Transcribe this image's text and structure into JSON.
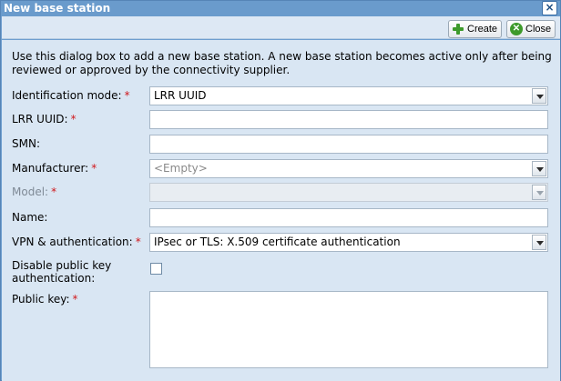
{
  "dialog": {
    "title": "New base station",
    "close_glyph": "×",
    "toolbar": {
      "create_label": "Create",
      "close_label": "Close"
    },
    "description": "Use this dialog box to add a new base station. A new base station becomes active only after being reviewed or approved by the connectivity supplier.",
    "required_marker": "*",
    "fields": {
      "identification_mode": {
        "label": "Identification mode:",
        "value": "LRR UUID",
        "required": true
      },
      "lrr_uuid": {
        "label": "LRR UUID:",
        "value": "",
        "required": true
      },
      "smn": {
        "label": "SMN:",
        "value": "",
        "required": false
      },
      "manufacturer": {
        "label": "Manufacturer:",
        "value": "<Empty>",
        "required": true
      },
      "model": {
        "label": "Model:",
        "value": "",
        "required": true,
        "disabled": true
      },
      "name": {
        "label": "Name:",
        "value": "",
        "required": false
      },
      "vpn_auth": {
        "label": "VPN & authentication:",
        "value": "IPsec or TLS: X.509 certificate authentication",
        "required": true
      },
      "disable_pubkey": {
        "label_line1": "Disable public key",
        "label_line2": "authentication:",
        "checked": false
      },
      "public_key": {
        "label": "Public key:",
        "value": "",
        "required": true
      }
    }
  },
  "icons": {
    "create": "plus-icon",
    "close": "close-circle-icon",
    "dialog_close": "close-icon",
    "dropdown": "chevron-down-icon"
  },
  "colors": {
    "titlebar": "#6a9bcc",
    "content_bg": "#d9e6f3",
    "required": "#d0181c",
    "icon_green": "#3d9a2b"
  }
}
